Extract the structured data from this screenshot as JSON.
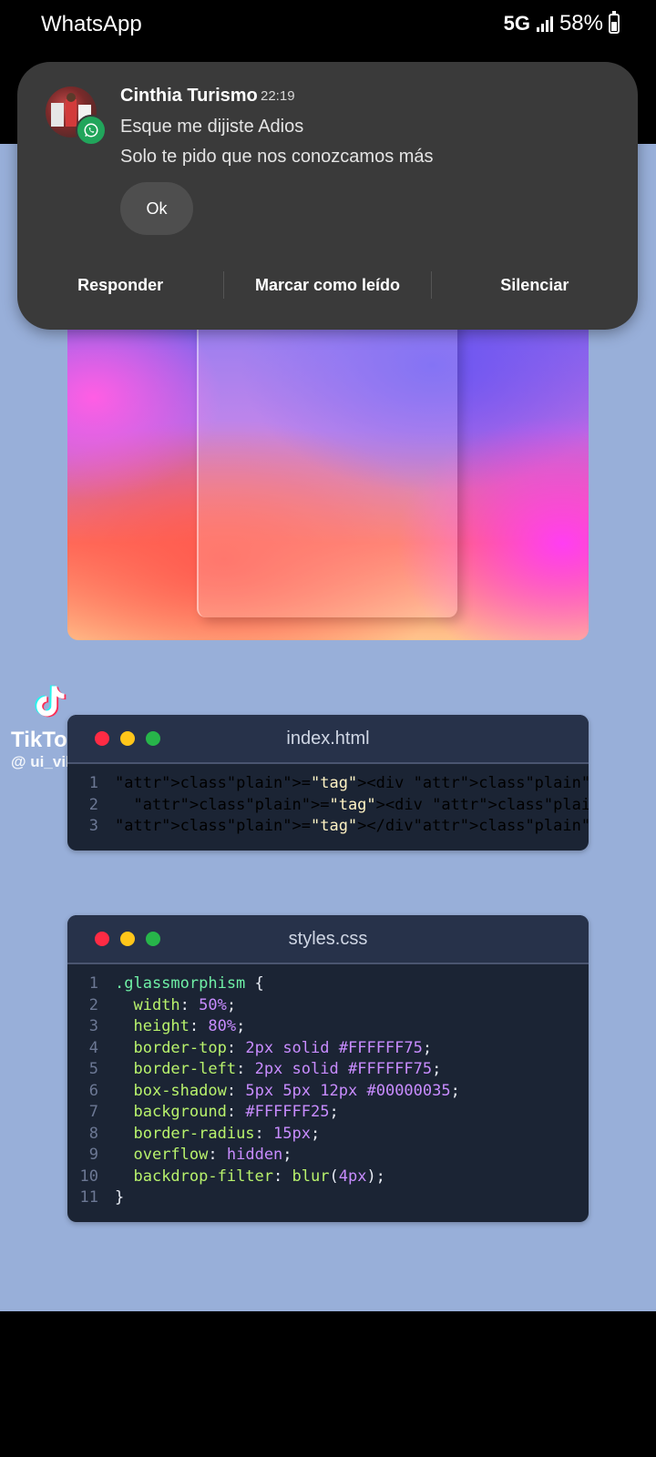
{
  "status_bar": {
    "app_name": "WhatsApp",
    "network": "5G",
    "battery": "58%"
  },
  "notification": {
    "sender": "Cinthia Turismo",
    "time": "22:19",
    "line1": "Esque me dijiste Adios",
    "line2": "Solo te pido que nos conozcamos más",
    "quick_reply": "Ok",
    "actions": [
      "Responder",
      "Marcar como leído",
      "Silenciar"
    ]
  },
  "tiktok": {
    "brand": "TikTok",
    "handle": "@ ui_vibes"
  },
  "html_window": {
    "title": "index.html",
    "lines": [
      {
        "n": "1",
        "text": "<div class=\"container\">"
      },
      {
        "n": "2",
        "text": "  <div class=\"glassmorphism\"></div>"
      },
      {
        "n": "3",
        "text": "</div>"
      }
    ]
  },
  "css_window": {
    "title": "styles.css",
    "lines": [
      {
        "n": "1",
        "text": ".glassmorphism {"
      },
      {
        "n": "2",
        "text": "  width: 50%;"
      },
      {
        "n": "3",
        "text": "  height: 80%;"
      },
      {
        "n": "4",
        "text": "  border-top: 2px solid #FFFFFF75;"
      },
      {
        "n": "5",
        "text": "  border-left: 2px solid #FFFFFF75;"
      },
      {
        "n": "6",
        "text": "  box-shadow: 5px 5px 12px #00000035;"
      },
      {
        "n": "7",
        "text": "  background: #FFFFFF25;"
      },
      {
        "n": "8",
        "text": "  border-radius: 15px;"
      },
      {
        "n": "9",
        "text": "  overflow: hidden;"
      },
      {
        "n": "10",
        "text": "  backdrop-filter: blur(4px);"
      },
      {
        "n": "11",
        "text": "}"
      }
    ]
  },
  "colors": {
    "notification_bg": "#3a3a3a",
    "video_bg": "#98afd9",
    "code_bg": "#1b2434",
    "whatsapp_green": "#21a55b"
  }
}
